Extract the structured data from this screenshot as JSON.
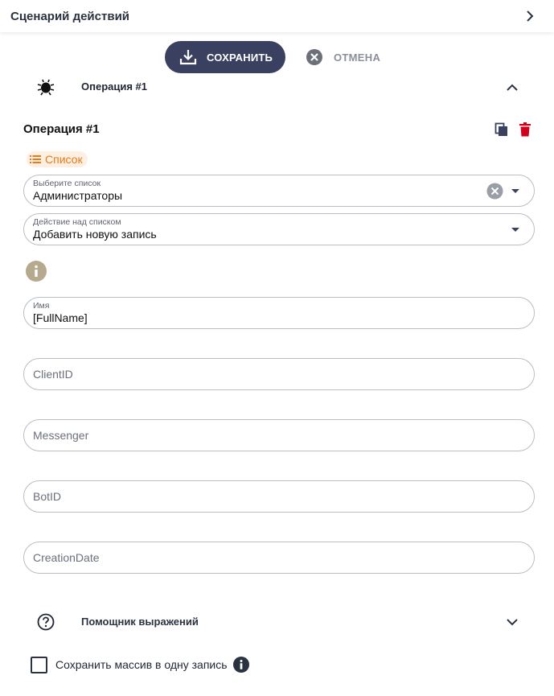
{
  "header": {
    "title": "Сценарий действий",
    "chevron_icon": "chevron-right-icon"
  },
  "toolbar": {
    "save_label": "СОХРАНИТЬ",
    "save_icon": "download-icon",
    "cancel_label": "ОТМЕНА",
    "cancel_icon": "close-circle-icon"
  },
  "operation": {
    "row_label": "Операция #1",
    "row_icon": "bug-icon",
    "title": "Операция #1",
    "badge_label": "Список",
    "badge_icon": "list-icon"
  },
  "fields": {
    "list": {
      "label": "Выберите список",
      "value": "Администраторы"
    },
    "action": {
      "label": "Действие над списком",
      "value": "Добавить новую запись"
    },
    "name": {
      "label": "Имя",
      "value": "[FullName]"
    },
    "client_id": {
      "placeholder": "ClientID"
    },
    "messenger": {
      "placeholder": "Messenger"
    },
    "bot_id": {
      "placeholder": "BotID"
    },
    "creation_date": {
      "placeholder": "CreationDate"
    }
  },
  "helper": {
    "label": "Помощник выражений",
    "icon": "help-circle-icon"
  },
  "checkbox": {
    "label": "Сохранить массив в одну запись",
    "checked": false
  },
  "colors": {
    "primary_button": "#3a4060",
    "badge_text": "#e87a1a",
    "badge_bg": "#fdf0e2",
    "delete_red": "#d0021b",
    "info_tan": "#b5a98e"
  }
}
